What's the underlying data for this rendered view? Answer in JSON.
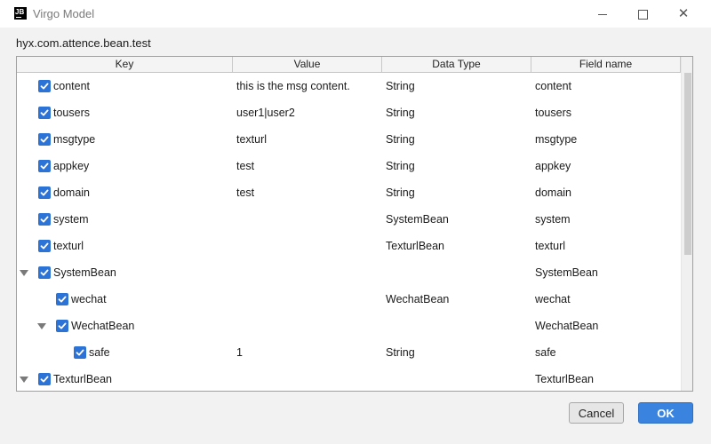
{
  "window": {
    "logo_text": "JB",
    "title": "Virgo Model",
    "minimize_icon": "minimize-icon",
    "maximize_icon": "maximize-icon",
    "close_icon": "close-icon",
    "close_glyph": "✕"
  },
  "dialog": {
    "package_name": "hyx.com.attence.bean.test"
  },
  "table": {
    "columns": [
      "Key",
      "Value",
      "Data Type",
      "Field name"
    ],
    "rows": [
      {
        "key": "content",
        "value": "this is the msg content.",
        "type": "String",
        "field": "content",
        "checked": true,
        "expandable": false,
        "level": 0
      },
      {
        "key": "tousers",
        "value": "user1|user2",
        "type": "String",
        "field": "tousers",
        "checked": true,
        "expandable": false,
        "level": 0
      },
      {
        "key": "msgtype",
        "value": "texturl",
        "type": "String",
        "field": "msgtype",
        "checked": true,
        "expandable": false,
        "level": 0
      },
      {
        "key": "appkey",
        "value": "test",
        "type": "String",
        "field": "appkey",
        "checked": true,
        "expandable": false,
        "level": 0
      },
      {
        "key": "domain",
        "value": "test",
        "type": "String",
        "field": "domain",
        "checked": true,
        "expandable": false,
        "level": 0
      },
      {
        "key": "system",
        "value": "",
        "type": "SystemBean",
        "field": "system",
        "checked": true,
        "expandable": false,
        "level": 0
      },
      {
        "key": "texturl",
        "value": "",
        "type": "TexturlBean",
        "field": "texturl",
        "checked": true,
        "expandable": false,
        "level": 0
      },
      {
        "key": "SystemBean",
        "value": "",
        "type": "",
        "field": "SystemBean",
        "checked": true,
        "expandable": true,
        "level": 0
      },
      {
        "key": "wechat",
        "value": "",
        "type": "WechatBean",
        "field": "wechat",
        "checked": true,
        "expandable": false,
        "level": 1
      },
      {
        "key": "WechatBean",
        "value": "",
        "type": "",
        "field": "WechatBean",
        "checked": true,
        "expandable": true,
        "level": 1
      },
      {
        "key": "safe",
        "value": "1",
        "type": "String",
        "field": "safe",
        "checked": true,
        "expandable": false,
        "level": 2
      },
      {
        "key": "TexturlBean",
        "value": "",
        "type": "",
        "field": "TexturlBean",
        "checked": true,
        "expandable": true,
        "level": 0
      }
    ]
  },
  "buttons": {
    "cancel": "Cancel",
    "ok": "OK"
  },
  "colors": {
    "checkbox": "#2b73d6",
    "ok_button": "#3a84e0"
  }
}
